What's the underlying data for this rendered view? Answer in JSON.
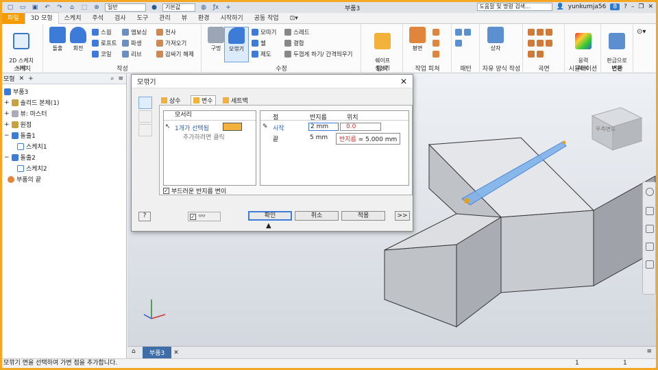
{
  "titlebar": {
    "style_dropdown": "일반",
    "material_dropdown": "기본값",
    "doc_title": "부품3",
    "search_placeholder": "도움말 및 명령 검색...",
    "user": "yunkumja56",
    "notification_count": "8"
  },
  "tabs": [
    "파일",
    "3D 모형",
    "스케치",
    "주석",
    "검사",
    "도구",
    "관리",
    "뷰",
    "환경",
    "시작하기",
    "공동 작업"
  ],
  "ribbon": {
    "sketch": {
      "big": "2D 스케치\n시작",
      "label": "스케치"
    },
    "create": {
      "label": "작성",
      "big": [
        "돌출",
        "회전"
      ],
      "small": [
        "스윕",
        "로프트",
        "코일",
        "엠보싱",
        "파생",
        "리브",
        "전사",
        "가져오기",
        "감싸기 해제"
      ]
    },
    "modify": {
      "label": "수정",
      "big": [
        "구멍",
        "모깎기"
      ],
      "small": [
        "모따기",
        "쉘",
        "제도",
        "스레드",
        "결합",
        "두껍게 하기/ 간격띄우기"
      ]
    },
    "explore": {
      "big": "쉐이프\n생성기",
      "label": "탐색"
    },
    "work": {
      "big": "평면",
      "label": "작업 피쳐"
    },
    "pattern": {
      "label": "패턴"
    },
    "freeform": {
      "big": "상자",
      "label": "자유 양식 작성"
    },
    "surface": {
      "label": "곡면"
    },
    "simulation": {
      "big": "응력\n해석",
      "label": "시뮬레이션"
    },
    "convert": {
      "big": "판금으로\n변환",
      "label": "변환"
    }
  },
  "browser": {
    "title": "모형",
    "items": [
      "부품3",
      "솔리드 본체(1)",
      "뷰: 마스터",
      "원점",
      "돌출1",
      "스케치1",
      "돌출2",
      "스케치2",
      "부품의 끝"
    ]
  },
  "dialog": {
    "title": "모깎기",
    "tabs": [
      "상수",
      "변수",
      "세트백"
    ],
    "edges_header": "모서리",
    "edge_selected": "1개가 선택됨",
    "edge_hint": "추가하려면 클릭",
    "table_headers": [
      "점",
      "반지름",
      "위치"
    ],
    "rows": [
      {
        "point": "시작",
        "radius": "2 mm",
        "position": "0.0"
      },
      {
        "point": "끝",
        "radius": "5 mm",
        "position": ""
      }
    ],
    "smooth_label": "부드러운 반지름 변이",
    "buttons": {
      "ok": "확인",
      "cancel": "취소",
      "apply": "적용",
      "more": ">>"
    }
  },
  "tooltip": {
    "key": "반지름",
    "value": "= 5.000 mm"
  },
  "viewcube_label": "우측면도",
  "doc_tab": "부품3",
  "status": {
    "message": "모깎기 면을 선택하여 가변 점을 추가합니다.",
    "n1": "1",
    "n2": "1"
  },
  "colors": {
    "accent_orange": "#f59b00",
    "selection_blue": "#3d7bd8",
    "fillet_blue": "#7fb2ea"
  }
}
